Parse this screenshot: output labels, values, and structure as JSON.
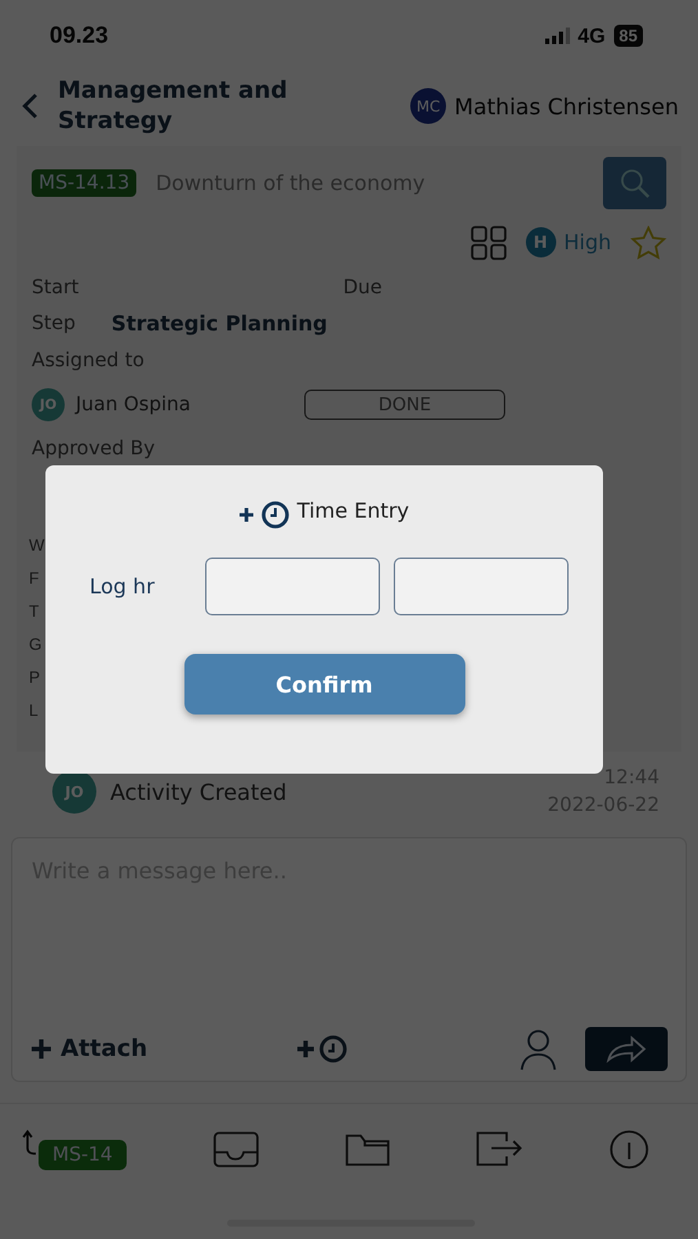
{
  "status_bar": {
    "time": "09.23",
    "network": "4G",
    "battery": "85"
  },
  "header": {
    "title": "Management and Strategy",
    "user": {
      "initials": "MC",
      "name": "Mathias Christensen"
    }
  },
  "task": {
    "code": "MS-14.13",
    "title": "Downturn of the economy",
    "priority": {
      "initial": "H",
      "label": "High"
    },
    "starred": false,
    "start_label": "Start",
    "due_label": "Due",
    "step": {
      "label": "Step",
      "value": "Strategic Planning"
    },
    "assigned": {
      "label": "Assigned to",
      "person": {
        "initials": "JO",
        "name": "Juan Ospina"
      },
      "status": "DONE"
    },
    "approved_label": "Approved By",
    "covered_labels": [
      "W",
      "F",
      "T",
      "G",
      "P",
      "L"
    ]
  },
  "activity": {
    "initials": "JO",
    "text": "Activity Created",
    "time": "12:44",
    "date": "2022-06-22"
  },
  "composer": {
    "placeholder": "Write a message here..",
    "attach": "Attach"
  },
  "nav": {
    "parent_code": "MS-14"
  },
  "dialog": {
    "title": "Time Entry",
    "field_label": "Log hr",
    "confirm": "Confirm"
  }
}
